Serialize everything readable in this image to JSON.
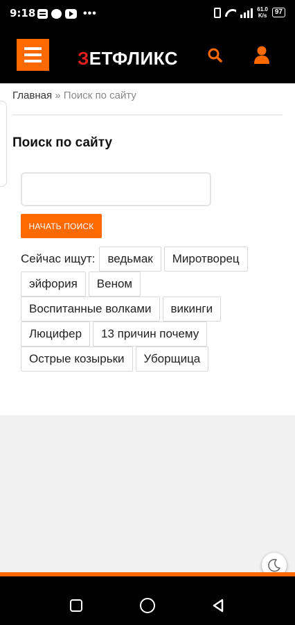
{
  "status_bar": {
    "time": "9:18",
    "dots": "•••",
    "speed_value": "61.0",
    "speed_unit": "K/s",
    "battery": "97"
  },
  "header": {
    "logo_first_letter": "З",
    "logo_rest": "ЕТФЛИКС",
    "accent_color": "#ff6a00",
    "logo_letter_color": "#e31e1e"
  },
  "breadcrumb": {
    "home": "Главная",
    "separator": " » ",
    "current": "Поиск по сайту"
  },
  "page": {
    "title": "Поиск по сайту"
  },
  "search": {
    "value": "",
    "placeholder": "",
    "button_label": "НАЧАТЬ ПОИСК"
  },
  "popular": {
    "label": "Сейчас ищут:",
    "tags": [
      "ведьмак",
      "Миротворец",
      "эйфория",
      "Веном",
      "Воспитанные волками",
      "викинги",
      "Люцифер",
      "13 причин почему",
      "Острые козырьки",
      "Уборщица"
    ]
  },
  "icons": {
    "menu": "hamburger-icon",
    "search": "search-icon",
    "user": "user-icon",
    "theme": "moon-icon"
  }
}
